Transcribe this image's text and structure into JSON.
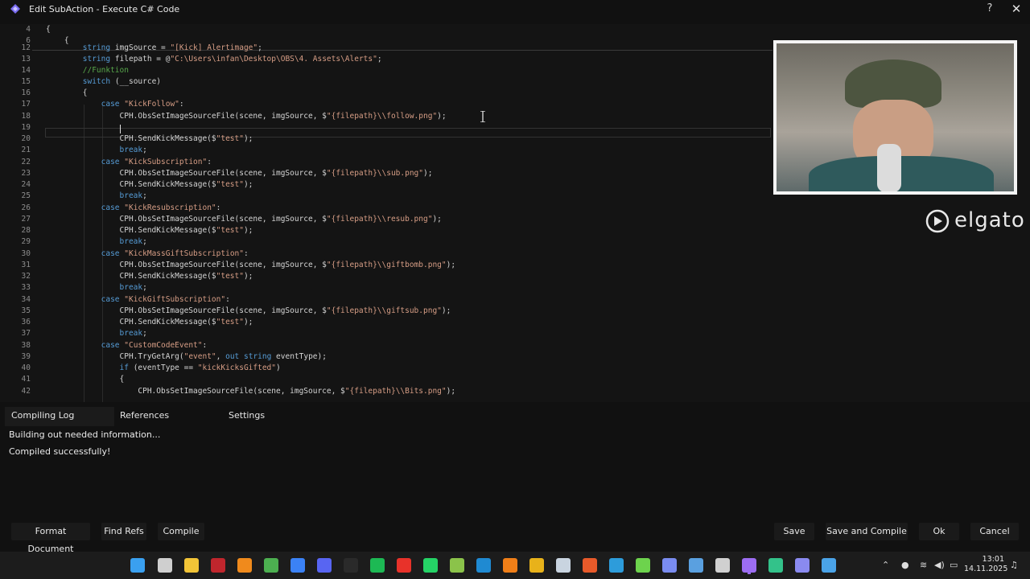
{
  "window": {
    "title": "Edit SubAction - Execute C# Code",
    "help": "?",
    "close": "✕"
  },
  "editor": {
    "lines": [
      {
        "n": "4",
        "t": "{",
        "c": ""
      },
      {
        "n": "6",
        "t": "    {",
        "c": ""
      },
      {
        "n": "12",
        "t": "        string imgSource = \"[Kick] Alertimage\";",
        "c": ""
      },
      {
        "n": "13",
        "t": "        string filepath = @\"C:\\Users\\infan\\Desktop\\OBS\\4. Assets\\Alerts\";",
        "c": ""
      },
      {
        "n": "14",
        "t": "        //Funktion",
        "c": "cm"
      },
      {
        "n": "15",
        "t": "        switch (__source)",
        "c": ""
      },
      {
        "n": "16",
        "t": "        {",
        "c": ""
      },
      {
        "n": "17",
        "t": "            case \"KickFollow\":",
        "c": ""
      },
      {
        "n": "18",
        "t": "                CPH.ObsSetImageSourceFile(scene, imgSource, $\"{filepath}\\\\follow.png\");",
        "c": ""
      },
      {
        "n": "19",
        "t": "",
        "c": ""
      },
      {
        "n": "20",
        "t": "                CPH.SendKickMessage($\"test\");",
        "c": ""
      },
      {
        "n": "21",
        "t": "                break;",
        "c": ""
      },
      {
        "n": "22",
        "t": "            case \"KickSubscription\":",
        "c": ""
      },
      {
        "n": "23",
        "t": "                CPH.ObsSetImageSourceFile(scene, imgSource, $\"{filepath}\\\\sub.png\");",
        "c": ""
      },
      {
        "n": "24",
        "t": "                CPH.SendKickMessage($\"test\");",
        "c": ""
      },
      {
        "n": "25",
        "t": "                break;",
        "c": ""
      },
      {
        "n": "26",
        "t": "            case \"KickResubscription\":",
        "c": ""
      },
      {
        "n": "27",
        "t": "                CPH.ObsSetImageSourceFile(scene, imgSource, $\"{filepath}\\\\resub.png\");",
        "c": ""
      },
      {
        "n": "28",
        "t": "                CPH.SendKickMessage($\"test\");",
        "c": ""
      },
      {
        "n": "29",
        "t": "                break;",
        "c": ""
      },
      {
        "n": "30",
        "t": "            case \"KickMassGiftSubscription\":",
        "c": ""
      },
      {
        "n": "31",
        "t": "                CPH.ObsSetImageSourceFile(scene, imgSource, $\"{filepath}\\\\giftbomb.png\");",
        "c": ""
      },
      {
        "n": "32",
        "t": "                CPH.SendKickMessage($\"test\");",
        "c": ""
      },
      {
        "n": "33",
        "t": "                break;",
        "c": ""
      },
      {
        "n": "34",
        "t": "            case \"KickGiftSubscription\":",
        "c": ""
      },
      {
        "n": "35",
        "t": "                CPH.ObsSetImageSourceFile(scene, imgSource, $\"{filepath}\\\\giftsub.png\");",
        "c": ""
      },
      {
        "n": "36",
        "t": "                CPH.SendKickMessage($\"test\");",
        "c": ""
      },
      {
        "n": "37",
        "t": "                break;",
        "c": ""
      },
      {
        "n": "38",
        "t": "            case \"CustomCodeEvent\":",
        "c": ""
      },
      {
        "n": "39",
        "t": "                CPH.TryGetArg(\"event\", out string eventType);",
        "c": ""
      },
      {
        "n": "40",
        "t": "                if (eventType == \"kickKicksGifted\")",
        "c": ""
      },
      {
        "n": "41",
        "t": "                {",
        "c": ""
      },
      {
        "n": "42",
        "t": "                    CPH.ObsSetImageSourceFile(scene, imgSource, $\"{filepath}\\\\Bits.png\");",
        "c": ""
      }
    ]
  },
  "overlay": {
    "brand": "elgato"
  },
  "tabs": [
    "Compiling Log",
    "References",
    "Settings"
  ],
  "log": [
    "Building out needed information...",
    "Compiled successfully!"
  ],
  "buttons": {
    "format": "Format Document",
    "find_refs": "Find Refs",
    "compile": "Compile",
    "save": "Save",
    "save_compile": "Save and Compile",
    "ok": "Ok",
    "cancel": "Cancel"
  },
  "taskbar": {
    "apps": [
      {
        "icon": "windows-start-icon",
        "color": "#3aa0f0"
      },
      {
        "icon": "search-icon",
        "color": "#cfcfcf"
      },
      {
        "icon": "file-explorer-icon",
        "color": "#f2c437"
      },
      {
        "icon": "filezilla-icon",
        "color": "#c0262d"
      },
      {
        "icon": "vlc-icon",
        "color": "#f08a1c"
      },
      {
        "icon": "chrome-icon",
        "color": "#4caf50"
      },
      {
        "icon": "chrome-alt-icon",
        "color": "#3b82f6"
      },
      {
        "icon": "discord-icon",
        "color": "#5865f2"
      },
      {
        "icon": "epic-games-icon",
        "color": "#2a2a2a"
      },
      {
        "icon": "spotify-icon",
        "color": "#1db954"
      },
      {
        "icon": "diamond-app-icon",
        "color": "#e8322a"
      },
      {
        "icon": "whatsapp-icon",
        "color": "#25d366"
      },
      {
        "icon": "notepad-plus-icon",
        "color": "#8bc34a"
      },
      {
        "icon": "vscode-icon",
        "color": "#1f8ad2"
      },
      {
        "icon": "app-orange-icon",
        "color": "#f07f18"
      },
      {
        "icon": "app-yellow-icon",
        "color": "#e8b21a"
      },
      {
        "icon": "steam-icon",
        "color": "#c9d4e0"
      },
      {
        "icon": "app-red-icon",
        "color": "#e85a2a"
      },
      {
        "icon": "app-blue-icon",
        "color": "#2d9cdb"
      },
      {
        "icon": "app-green-icon",
        "color": "#6dd34d"
      },
      {
        "icon": "obs-icon",
        "color": "#7a8cf0"
      },
      {
        "icon": "app-tools-icon",
        "color": "#5aa0e0"
      },
      {
        "icon": "app-cam-icon",
        "color": "#d0d0d0"
      },
      {
        "icon": "streamerbot-icon",
        "color": "#9c6df2"
      },
      {
        "icon": "app-dark-icon",
        "color": "#33c28a"
      },
      {
        "icon": "app-arrow-icon",
        "color": "#8a8af0"
      },
      {
        "icon": "notepad-icon",
        "color": "#4aa3e8"
      }
    ],
    "time": "13:01",
    "date": "14.11.2025"
  }
}
